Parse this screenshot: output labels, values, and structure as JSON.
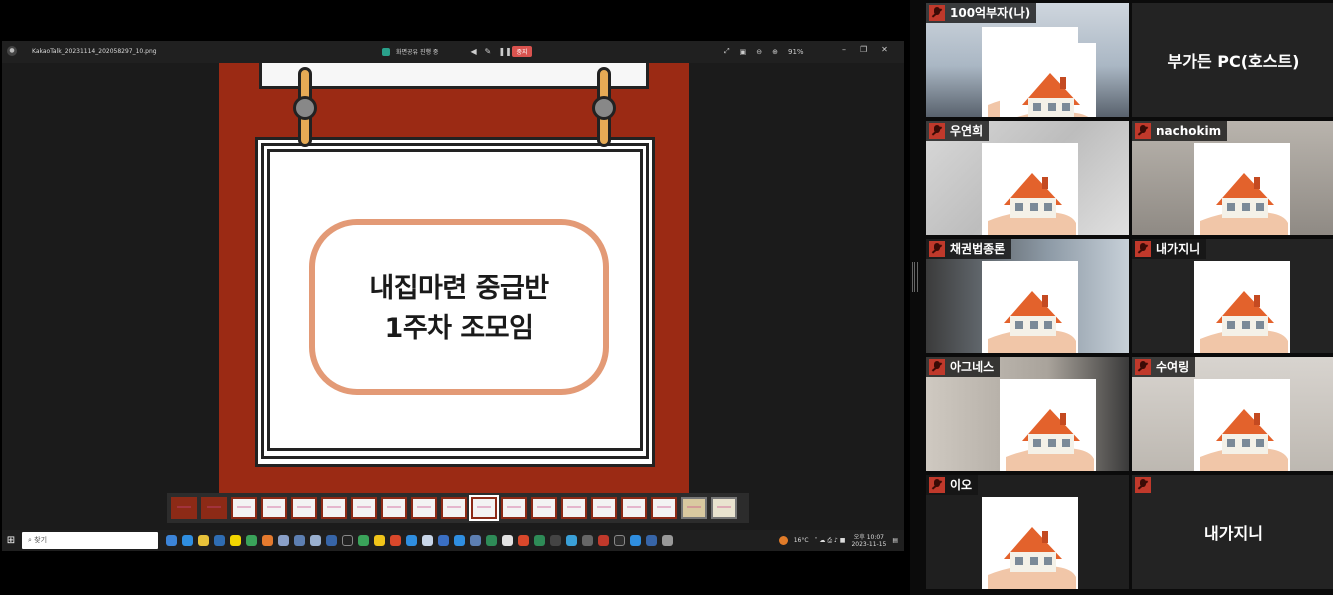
{
  "viewer": {
    "filename": "KakaoTalk_20231114_202058297_10.png",
    "share_status": "화면공유 진행 중",
    "stop_label": "중지",
    "zoom": "91%"
  },
  "slide": {
    "line1": "내집마련 중급반",
    "line2": "1주차 조모임"
  },
  "taskbar": {
    "search_placeholder": "찾기",
    "temperature": "16°C",
    "time": "오후 10:07",
    "date": "2023-11-15"
  },
  "participants": [
    {
      "name": "100억부자(나)"
    },
    {
      "name": "부가든 PC(호스트)"
    },
    {
      "name": "우연희"
    },
    {
      "name": "nachokim"
    },
    {
      "name": "채권법종론"
    },
    {
      "name": "내가지니"
    },
    {
      "name": "아그네스"
    },
    {
      "name": "수여링"
    },
    {
      "name": "이오"
    },
    {
      "name": "내가지니"
    }
  ],
  "colors": {
    "slide_bg": "#9b2a14",
    "badge_border": "#e39a76",
    "mic_muted": "#c0392b"
  }
}
